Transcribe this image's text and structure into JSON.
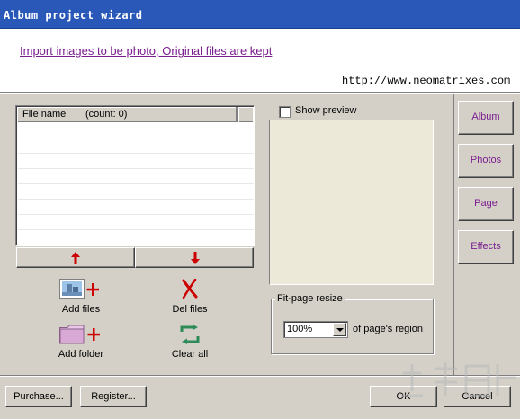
{
  "window": {
    "title": "Album project wizard"
  },
  "header": {
    "link_text": "Import images to be photo, Original files are kept",
    "website": "http://www.neomatrixes.com"
  },
  "file_list": {
    "col_name": "File name",
    "col_count": "(count: 0)",
    "move_up_icon": "arrow-up-icon",
    "move_down_icon": "arrow-down-icon"
  },
  "actions": {
    "add_files": "Add files",
    "del_files": "Del files",
    "add_folder": "Add folder",
    "clear_all": "Clear all"
  },
  "preview": {
    "checkbox_label": "Show preview",
    "checked": false
  },
  "fit_page": {
    "group_title": "Fit-page resize",
    "zoom_value": "100%",
    "suffix": "of page's region"
  },
  "nav": {
    "album": "Album",
    "photos": "Photos",
    "page": "Page",
    "effects": "Effects"
  },
  "footer": {
    "purchase": "Purchase...",
    "register": "Register...",
    "ok": "OK",
    "cancel": "Cancel"
  },
  "colors": {
    "title_bar": "#2a58b9",
    "link": "#7a1d8e",
    "nav_text": "#7a1d8e",
    "arrow": "#cc0000"
  }
}
